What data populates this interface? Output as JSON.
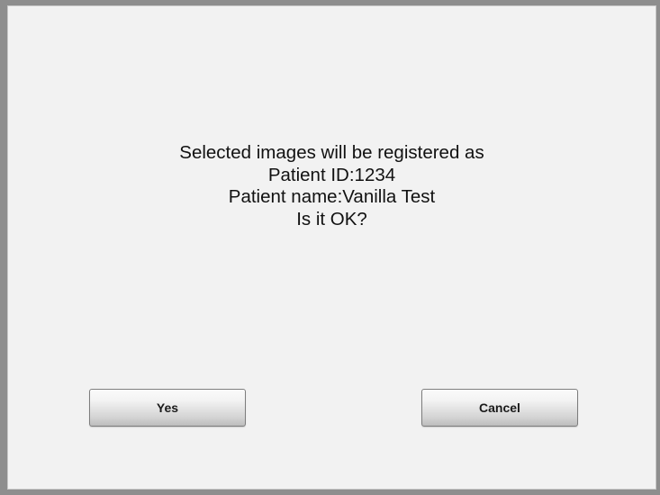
{
  "dialog": {
    "message_lines": [
      "Selected images will be registered as",
      "Patient ID:1234",
      "Patient name:Vanilla Test",
      "Is it OK?"
    ],
    "yes_label": "Yes",
    "cancel_label": "Cancel"
  }
}
